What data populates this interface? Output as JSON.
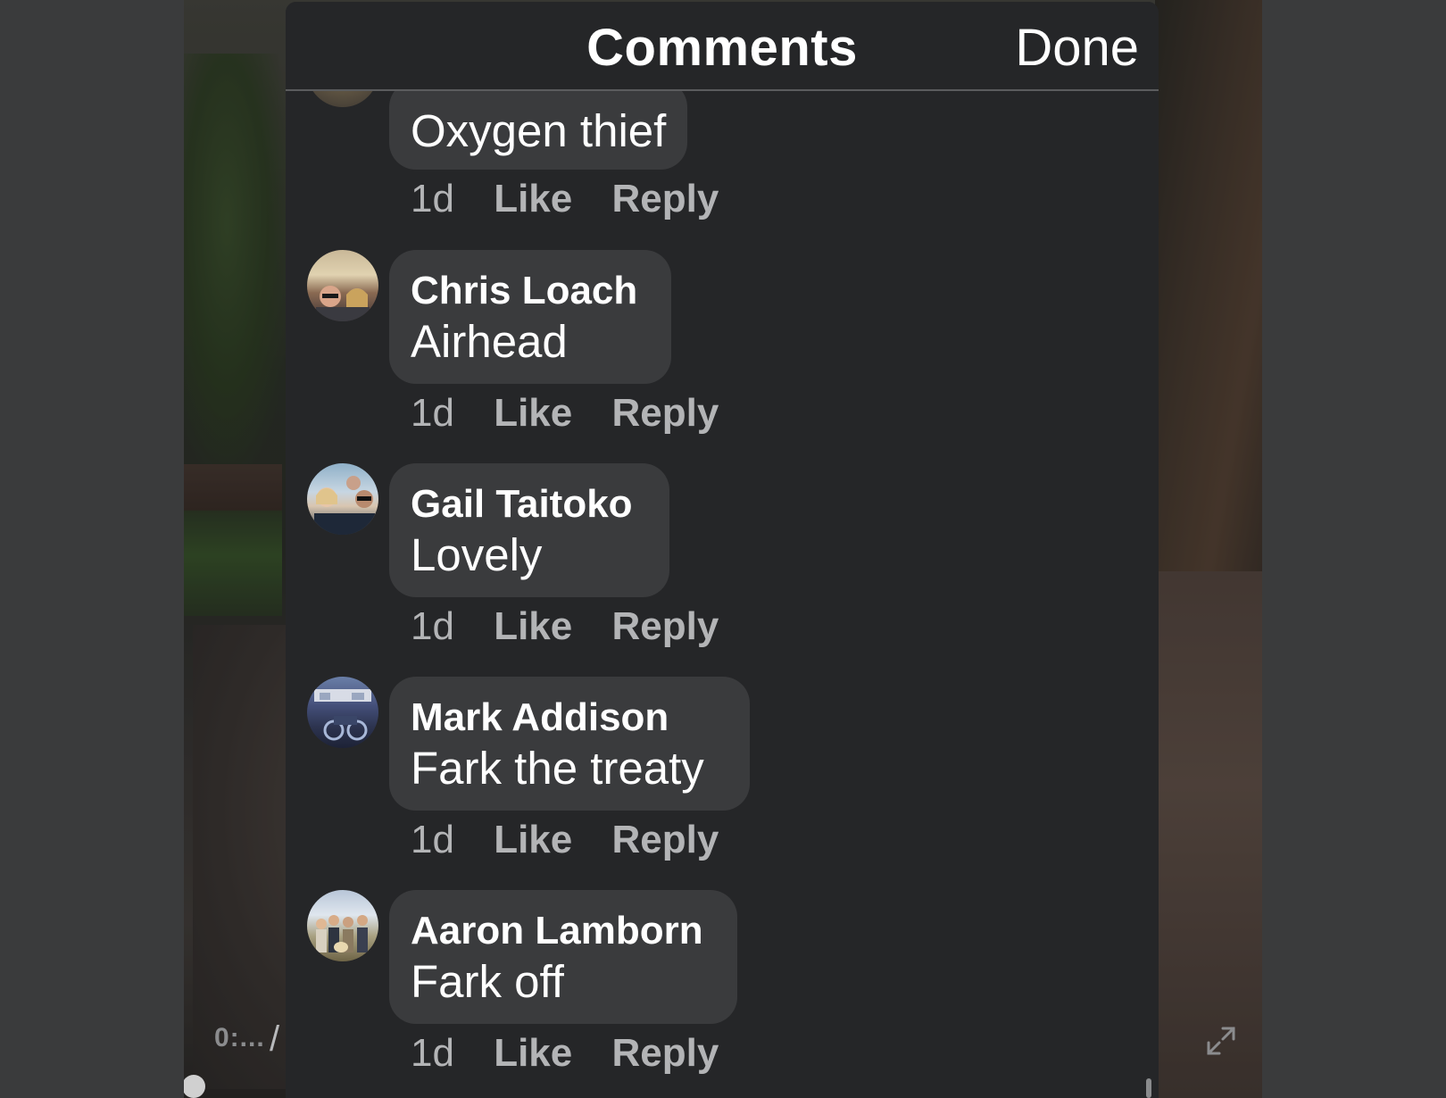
{
  "video": {
    "time_label": "0:...",
    "time_separator": "/"
  },
  "sheet": {
    "title": "Comments",
    "done_label": "Done"
  },
  "comments": [
    {
      "author": "",
      "text": "Oxygen thief",
      "time": "1d",
      "like": "Like",
      "reply": "Reply"
    },
    {
      "author": "Chris Loach",
      "text": "Airhead",
      "time": "1d",
      "like": "Like",
      "reply": "Reply"
    },
    {
      "author": "Gail Taitoko",
      "text": "Lovely",
      "time": "1d",
      "like": "Like",
      "reply": "Reply"
    },
    {
      "author": "Mark Addison",
      "text": "Fark the treaty",
      "time": "1d",
      "like": "Like",
      "reply": "Reply"
    },
    {
      "author": "Aaron Lamborn",
      "text": "Fark off",
      "time": "1d",
      "like": "Like",
      "reply": "Reply"
    }
  ],
  "colors": {
    "sheet_bg": "#252628",
    "bubble_bg": "#3a3b3d",
    "action_text": "#b3b4b6"
  },
  "icons": {
    "expand": "expand-icon",
    "avatar": "avatar-photo"
  }
}
